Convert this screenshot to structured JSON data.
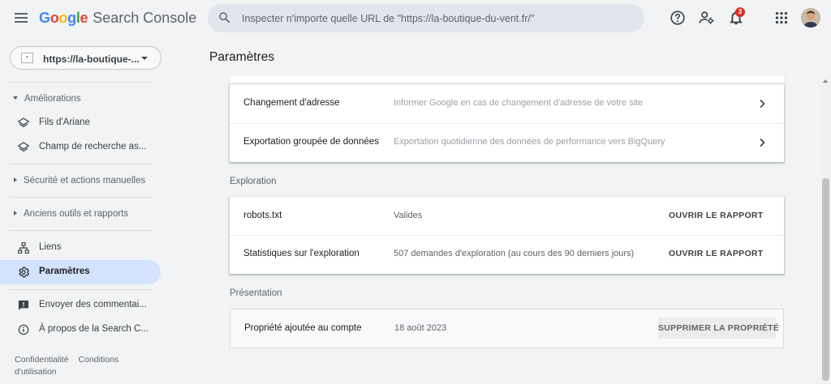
{
  "header": {
    "logo": {
      "letters": [
        {
          "ch": "G",
          "color": "#4285F4"
        },
        {
          "ch": "o",
          "color": "#EA4335"
        },
        {
          "ch": "o",
          "color": "#FBBC05"
        },
        {
          "ch": "g",
          "color": "#4285F4"
        },
        {
          "ch": "l",
          "color": "#34A853"
        },
        {
          "ch": "e",
          "color": "#EA4335"
        }
      ],
      "product": "Search Console"
    },
    "search": {
      "placeholder": "Inspecter n'importe quelle URL de \"https://la-boutique-du-vent.fr/\""
    },
    "icons": [
      "help-icon",
      "manage-users-icon",
      "notifications-icon",
      "apps-icon"
    ],
    "notification_count": "3"
  },
  "sidebar": {
    "property": "https://la-boutique-...",
    "sections": {
      "ameliorations": "Améliorations",
      "securite": "Sécurité et actions manuelles",
      "anciens": "Anciens outils et rapports"
    },
    "items": {
      "fils": "Fils d'Ariane",
      "champ": "Champ de recherche as...",
      "liens": "Liens",
      "parametres": "Paramètres",
      "commentaires": "Envoyer des commentai...",
      "apropos": "À propos de la Search C..."
    },
    "footer": {
      "confidentialite": "Confidentialité",
      "conditions": "Conditions d'utilisation"
    }
  },
  "main": {
    "title": "Paramètres",
    "general_rows": [
      {
        "label": "Changement d'adresse",
        "desc": "Informer Google en cas de changement d'adresse de votre site"
      },
      {
        "label": "Exportation groupée de données",
        "desc": "Exportation quotidienne des données de performance vers BigQuery"
      }
    ],
    "exploration": {
      "heading": "Exploration",
      "rows": [
        {
          "label": "robots.txt",
          "desc": "Valides",
          "action": "OUVRIR LE RAPPORT"
        },
        {
          "label": "Statistiques sur l'exploration",
          "desc": "507 demandes d'exploration (au cours des 90 derniers jours)",
          "action": "OUVRIR LE RAPPORT"
        }
      ]
    },
    "presentation": {
      "heading": "Présentation",
      "label": "Propriété ajoutée au compte",
      "date": "18 août 2023",
      "delete_label": "SUPPRIMER LA PROPRIÉTÉ"
    }
  },
  "colors": {
    "active_nav": "#d3e3fd",
    "notification_badge": "#d93025"
  }
}
